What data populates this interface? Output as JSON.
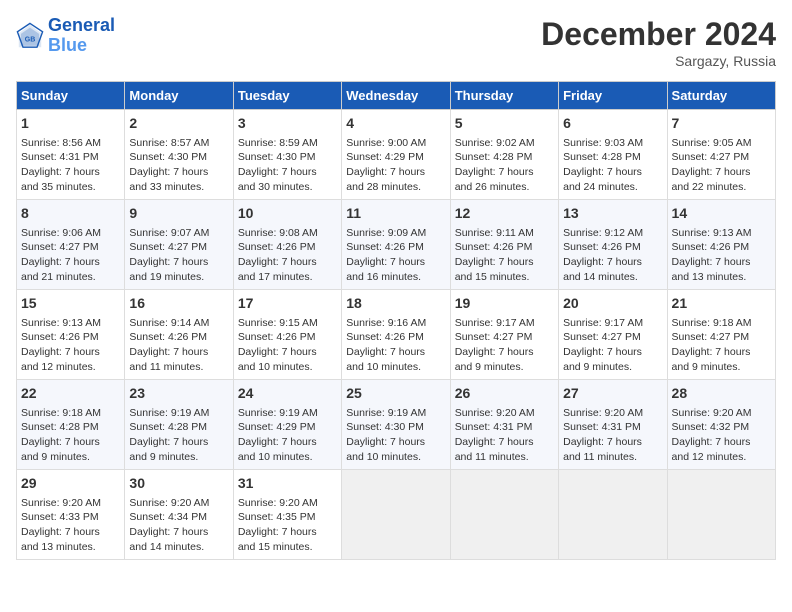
{
  "header": {
    "logo_line1": "General",
    "logo_line2": "Blue",
    "month": "December 2024",
    "location": "Sargazy, Russia"
  },
  "days_of_week": [
    "Sunday",
    "Monday",
    "Tuesday",
    "Wednesday",
    "Thursday",
    "Friday",
    "Saturday"
  ],
  "weeks": [
    [
      {
        "day": "1",
        "info": "Sunrise: 8:56 AM\nSunset: 4:31 PM\nDaylight: 7 hours\nand 35 minutes."
      },
      {
        "day": "2",
        "info": "Sunrise: 8:57 AM\nSunset: 4:30 PM\nDaylight: 7 hours\nand 33 minutes."
      },
      {
        "day": "3",
        "info": "Sunrise: 8:59 AM\nSunset: 4:30 PM\nDaylight: 7 hours\nand 30 minutes."
      },
      {
        "day": "4",
        "info": "Sunrise: 9:00 AM\nSunset: 4:29 PM\nDaylight: 7 hours\nand 28 minutes."
      },
      {
        "day": "5",
        "info": "Sunrise: 9:02 AM\nSunset: 4:28 PM\nDaylight: 7 hours\nand 26 minutes."
      },
      {
        "day": "6",
        "info": "Sunrise: 9:03 AM\nSunset: 4:28 PM\nDaylight: 7 hours\nand 24 minutes."
      },
      {
        "day": "7",
        "info": "Sunrise: 9:05 AM\nSunset: 4:27 PM\nDaylight: 7 hours\nand 22 minutes."
      }
    ],
    [
      {
        "day": "8",
        "info": "Sunrise: 9:06 AM\nSunset: 4:27 PM\nDaylight: 7 hours\nand 21 minutes."
      },
      {
        "day": "9",
        "info": "Sunrise: 9:07 AM\nSunset: 4:27 PM\nDaylight: 7 hours\nand 19 minutes."
      },
      {
        "day": "10",
        "info": "Sunrise: 9:08 AM\nSunset: 4:26 PM\nDaylight: 7 hours\nand 17 minutes."
      },
      {
        "day": "11",
        "info": "Sunrise: 9:09 AM\nSunset: 4:26 PM\nDaylight: 7 hours\nand 16 minutes."
      },
      {
        "day": "12",
        "info": "Sunrise: 9:11 AM\nSunset: 4:26 PM\nDaylight: 7 hours\nand 15 minutes."
      },
      {
        "day": "13",
        "info": "Sunrise: 9:12 AM\nSunset: 4:26 PM\nDaylight: 7 hours\nand 14 minutes."
      },
      {
        "day": "14",
        "info": "Sunrise: 9:13 AM\nSunset: 4:26 PM\nDaylight: 7 hours\nand 13 minutes."
      }
    ],
    [
      {
        "day": "15",
        "info": "Sunrise: 9:13 AM\nSunset: 4:26 PM\nDaylight: 7 hours\nand 12 minutes."
      },
      {
        "day": "16",
        "info": "Sunrise: 9:14 AM\nSunset: 4:26 PM\nDaylight: 7 hours\nand 11 minutes."
      },
      {
        "day": "17",
        "info": "Sunrise: 9:15 AM\nSunset: 4:26 PM\nDaylight: 7 hours\nand 10 minutes."
      },
      {
        "day": "18",
        "info": "Sunrise: 9:16 AM\nSunset: 4:26 PM\nDaylight: 7 hours\nand 10 minutes."
      },
      {
        "day": "19",
        "info": "Sunrise: 9:17 AM\nSunset: 4:27 PM\nDaylight: 7 hours\nand 9 minutes."
      },
      {
        "day": "20",
        "info": "Sunrise: 9:17 AM\nSunset: 4:27 PM\nDaylight: 7 hours\nand 9 minutes."
      },
      {
        "day": "21",
        "info": "Sunrise: 9:18 AM\nSunset: 4:27 PM\nDaylight: 7 hours\nand 9 minutes."
      }
    ],
    [
      {
        "day": "22",
        "info": "Sunrise: 9:18 AM\nSunset: 4:28 PM\nDaylight: 7 hours\nand 9 minutes."
      },
      {
        "day": "23",
        "info": "Sunrise: 9:19 AM\nSunset: 4:28 PM\nDaylight: 7 hours\nand 9 minutes."
      },
      {
        "day": "24",
        "info": "Sunrise: 9:19 AM\nSunset: 4:29 PM\nDaylight: 7 hours\nand 10 minutes."
      },
      {
        "day": "25",
        "info": "Sunrise: 9:19 AM\nSunset: 4:30 PM\nDaylight: 7 hours\nand 10 minutes."
      },
      {
        "day": "26",
        "info": "Sunrise: 9:20 AM\nSunset: 4:31 PM\nDaylight: 7 hours\nand 11 minutes."
      },
      {
        "day": "27",
        "info": "Sunrise: 9:20 AM\nSunset: 4:31 PM\nDaylight: 7 hours\nand 11 minutes."
      },
      {
        "day": "28",
        "info": "Sunrise: 9:20 AM\nSunset: 4:32 PM\nDaylight: 7 hours\nand 12 minutes."
      }
    ],
    [
      {
        "day": "29",
        "info": "Sunrise: 9:20 AM\nSunset: 4:33 PM\nDaylight: 7 hours\nand 13 minutes."
      },
      {
        "day": "30",
        "info": "Sunrise: 9:20 AM\nSunset: 4:34 PM\nDaylight: 7 hours\nand 14 minutes."
      },
      {
        "day": "31",
        "info": "Sunrise: 9:20 AM\nSunset: 4:35 PM\nDaylight: 7 hours\nand 15 minutes."
      },
      null,
      null,
      null,
      null
    ]
  ]
}
